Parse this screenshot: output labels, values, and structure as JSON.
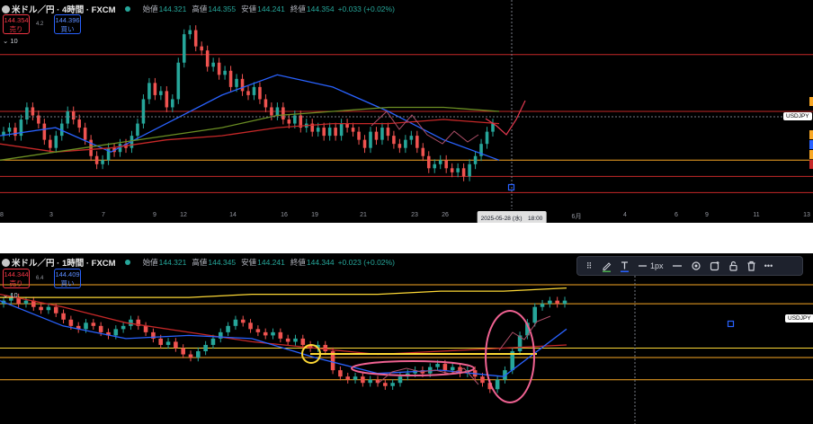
{
  "panels": [
    {
      "header": {
        "symbol": "米ドル／円 · 4時間 · FXCM",
        "open_label": "始値",
        "open": "144.321",
        "high_label": "高値",
        "high": "144.355",
        "low_label": "安値",
        "low": "144.241",
        "close_label": "終値",
        "close": "144.354",
        "change": "+0.033 (+0.02%)"
      },
      "sell": {
        "price": "144.354",
        "label": "売り"
      },
      "buy": {
        "price": "144.396",
        "label": "買い"
      },
      "spread": "4.2",
      "indicator_count": "10",
      "price_tag": "USDJPY",
      "x_ticks": [
        "3",
        "7",
        "9",
        "12",
        "14",
        "16",
        "19",
        "21",
        "23",
        "26",
        "6月",
        "4",
        "6",
        "9",
        "11",
        "13"
      ],
      "crosshair_date": "2025-05-28 (水)　18:00"
    },
    {
      "header": {
        "symbol": "米ドル／円 · 1時間 · FXCM",
        "open_label": "始値",
        "open": "144.321",
        "high_label": "高値",
        "high": "144.345",
        "low_label": "安値",
        "low": "144.241",
        "close_label": "終値",
        "close": "144.344",
        "change": "+0.023 (+0.02%)"
      },
      "sell": {
        "price": "144.344",
        "label": "売り"
      },
      "buy": {
        "price": "144.409",
        "label": "買い"
      },
      "spread": "6.4",
      "indicator_count": "10",
      "price_tag": "USDJPY",
      "toolbar": {
        "icons": [
          "drag-handle-icon",
          "pencil-icon",
          "text-icon",
          "line-style-icon",
          "line-width-icon",
          "settings-icon",
          "alert-icon",
          "lock-icon",
          "trash-icon",
          "more-icon"
        ],
        "width_label": "1px",
        "colors": {
          "pencil": "#4caf50",
          "text": "#2962ff"
        }
      }
    }
  ],
  "chart_data": [
    {
      "type": "candlestick",
      "title": "米ドル／円 · 4時間 · FXCM",
      "x_tick_labels": [
        "3",
        "7",
        "9",
        "12",
        "14",
        "16",
        "19",
        "21",
        "23",
        "26",
        "6月",
        "4",
        "6",
        "9",
        "11",
        "13"
      ],
      "ylim": [
        141.9,
        146.5
      ],
      "closes": [
        143.7,
        143.8,
        143.6,
        144.0,
        144.3,
        144.1,
        143.9,
        143.5,
        143.3,
        143.6,
        143.9,
        144.2,
        144.0,
        143.8,
        143.5,
        143.1,
        142.9,
        143.0,
        143.3,
        143.2,
        143.4,
        143.3,
        143.6,
        143.9,
        144.5,
        144.9,
        144.6,
        144.7,
        144.3,
        144.5,
        145.4,
        146.1,
        146.2,
        145.8,
        145.7,
        145.3,
        145.4,
        145.1,
        145.2,
        144.8,
        145.0,
        144.7,
        144.6,
        144.8,
        144.5,
        144.3,
        144.1,
        144.3,
        144.0,
        143.9,
        144.1,
        143.8,
        143.9,
        143.7,
        143.8,
        143.6,
        143.8,
        143.6,
        143.9,
        143.8,
        143.7,
        143.5,
        143.3,
        143.7,
        143.5,
        143.8,
        143.6,
        143.4,
        143.3,
        143.5,
        143.6,
        143.3,
        143.1,
        142.8,
        142.9,
        143.0,
        142.8,
        142.7,
        142.8,
        142.6,
        142.9,
        143.1,
        143.4,
        143.7,
        143.9
      ],
      "series": [
        {
          "name": "",
          "color": "#2962ff",
          "values": [
            143.6,
            143.8,
            143.2,
            143.9,
            144.6,
            145.1,
            144.8,
            144.2,
            143.5,
            143.0
          ]
        },
        {
          "name": "",
          "color": "#c62828",
          "values": [
            143.4,
            143.2,
            143.3,
            143.5,
            143.6,
            143.8,
            143.9,
            143.9,
            144.0,
            143.9
          ]
        },
        {
          "name": "",
          "color": "#6b8e23",
          "values": [
            143.0,
            143.2,
            143.4,
            143.6,
            143.8,
            144.1,
            144.2,
            144.3,
            144.3,
            144.2
          ]
        }
      ],
      "horizontal_levels": [
        {
          "price": 145.6,
          "color": "#c62828"
        },
        {
          "price": 144.2,
          "color": "#c62828"
        },
        {
          "price": 143.0,
          "color": "#f9a825"
        },
        {
          "price": 142.6,
          "color": "#c62828"
        },
        {
          "price": 142.2,
          "color": "#c62828"
        }
      ],
      "annotations": [
        "projection-path",
        "crosshair",
        "anchor-marker"
      ]
    },
    {
      "type": "candlestick",
      "title": "米ドル／円 · 1時間 · FXCM",
      "x_tick_labels": [],
      "ylim": [
        141.9,
        146.5
      ],
      "closes": [
        145.8,
        145.9,
        145.7,
        145.8,
        145.6,
        145.5,
        145.6,
        145.4,
        145.2,
        145.0,
        144.9,
        145.1,
        145.0,
        144.8,
        144.7,
        144.9,
        145.0,
        145.2,
        145.0,
        144.8,
        144.6,
        144.4,
        144.5,
        144.3,
        144.1,
        144.0,
        144.2,
        144.4,
        144.6,
        144.8,
        145.0,
        145.2,
        145.1,
        144.9,
        144.8,
        144.7,
        144.8,
        144.6,
        144.5,
        144.6,
        144.4,
        144.3,
        144.4,
        144.2,
        143.6,
        143.4,
        143.3,
        143.4,
        143.2,
        143.3,
        143.2,
        143.1,
        143.2,
        143.4,
        143.5,
        143.6,
        143.5,
        143.7,
        143.8,
        143.6,
        143.7,
        143.5,
        143.6,
        143.4,
        143.2,
        143.0,
        143.3,
        143.6,
        144.2,
        144.7,
        145.1,
        145.6,
        145.7,
        145.8,
        145.7,
        145.8
      ],
      "series": [
        {
          "name": "",
          "color": "#fdd835",
          "values": [
            145.9,
            145.9,
            145.9,
            145.9,
            146.0,
            146.0,
            146.0,
            146.1,
            146.1,
            146.2
          ]
        },
        {
          "name": "",
          "color": "#c62828",
          "values": [
            146.0,
            145.6,
            145.1,
            144.8,
            144.5,
            144.3,
            144.1,
            144.2,
            144.3,
            144.4
          ]
        },
        {
          "name": "",
          "color": "#2962ff",
          "values": [
            145.8,
            145.0,
            144.6,
            144.7,
            144.6,
            144.0,
            143.5,
            143.6,
            143.4,
            144.9
          ]
        }
      ],
      "horizontal_levels": [
        {
          "price": 146.3,
          "color": "#f9a825"
        },
        {
          "price": 145.7,
          "color": "#f9a825"
        },
        {
          "price": 144.3,
          "color": "#fdd835"
        },
        {
          "price": 144.0,
          "color": "#f9a825"
        },
        {
          "price": 143.3,
          "color": "#f9a825"
        }
      ],
      "annotations": [
        "yellow-circle",
        "pink-ellipse-range",
        "pink-ellipse-breakout",
        "yellow-support-line"
      ]
    }
  ]
}
